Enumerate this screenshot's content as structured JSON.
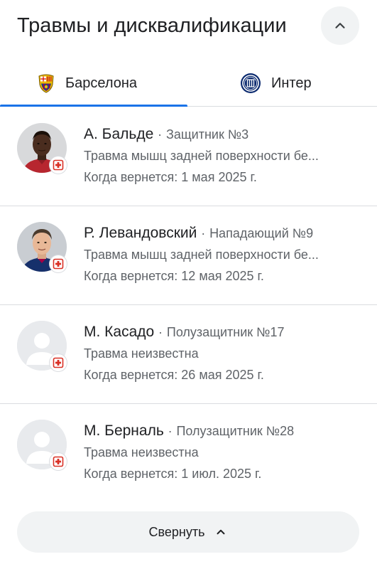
{
  "header": {
    "title": "Травмы и дисквалификации",
    "collapse_icon": "chevron-up-icon"
  },
  "tabs": [
    {
      "label": "Барселона",
      "icon": "barcelona-crest-icon",
      "selected": true
    },
    {
      "label": "Интер",
      "icon": "inter-crest-icon",
      "selected": false
    }
  ],
  "players": [
    {
      "name": "А. Бальде",
      "separator": "·",
      "position": "Защитник №3",
      "injury": "Травма мышц задней поверхности бе...",
      "return": "Когда вернется: 1 мая 2025 г.",
      "avatar": "photo"
    },
    {
      "name": "Р. Левандовский",
      "separator": "·",
      "position": "Нападающий №9",
      "injury": "Травма мышц задней поверхности бе...",
      "return": "Когда вернется: 12 мая 2025 г.",
      "avatar": "photo"
    },
    {
      "name": "М. Касадо",
      "separator": "·",
      "position": "Полузащитник №17",
      "injury": "Травма неизвестна",
      "return": "Когда вернется: 26 мая 2025 г.",
      "avatar": "placeholder"
    },
    {
      "name": "М. Берналь",
      "separator": "·",
      "position": "Полузащитник №28",
      "injury": "Травма неизвестна",
      "return": "Когда вернется: 1 июл. 2025 г.",
      "avatar": "placeholder"
    }
  ],
  "footer": {
    "collapse_label": "Свернуть",
    "collapse_icon": "chevron-up-icon"
  },
  "colors": {
    "accent": "#1a73e8",
    "injury": "#d93025",
    "barcelona_blue": "#004d98",
    "barcelona_red": "#a50044",
    "inter_blue": "#0b2a6f"
  }
}
